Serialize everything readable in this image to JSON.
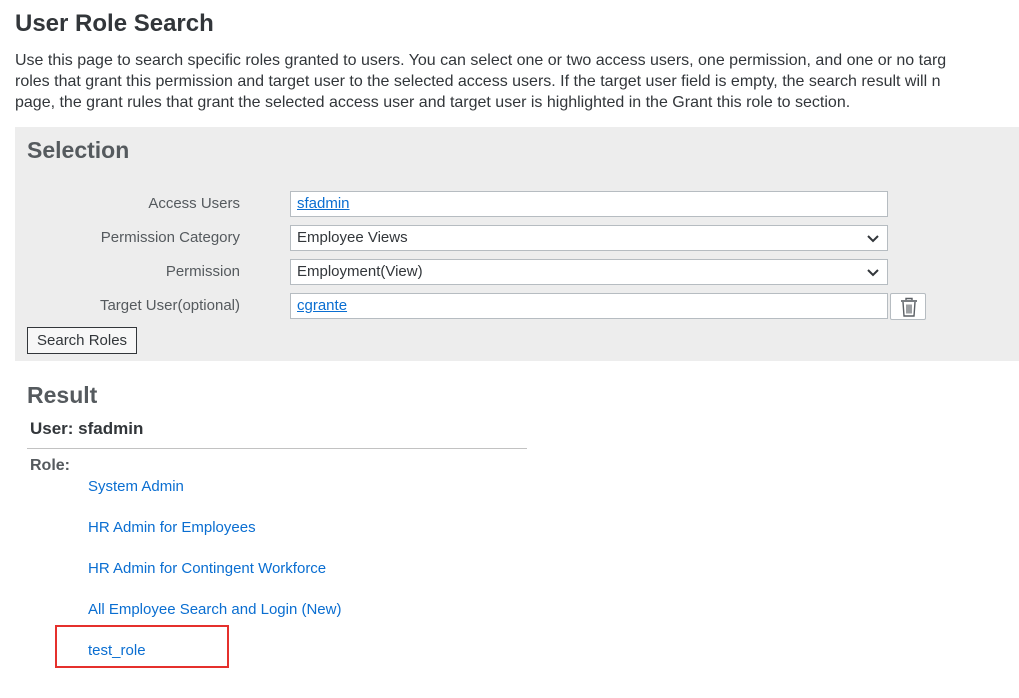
{
  "page": {
    "title": "User Role Search",
    "intro_lines": [
      "Use this page to search specific roles granted to users. You can select one or two access users, one permission, and one or no targ",
      "roles that grant this permission and target user to the selected access users. If the target user field is empty, the search result will n",
      "page, the grant rules that grant the selected access user and target user is highlighted in the Grant this role to section."
    ]
  },
  "selection": {
    "title": "Selection",
    "access_users": {
      "label": "Access Users",
      "value": "sfadmin"
    },
    "permission_category": {
      "label": "Permission Category",
      "value": "Employee Views",
      "icon": "chevron-down-icon"
    },
    "permission": {
      "label": "Permission",
      "value": "Employment(View)",
      "icon": "chevron-down-icon"
    },
    "target_user": {
      "label": "Target User(optional)",
      "value": "cgrante",
      "clear_icon": "trash-icon"
    },
    "search_button": "Search Roles"
  },
  "result": {
    "title": "Result",
    "user_heading": "User: sfadmin",
    "role_label": "Role:",
    "roles": [
      "System Admin",
      "HR Admin for Employees",
      "HR Admin for Contingent Workforce",
      "All Employee Search and Login (New)",
      "test_role"
    ],
    "highlighted_role": "test_role",
    "highlight_color": "#e5302c"
  },
  "colors": {
    "link": "#0a6ed1",
    "panel_background": "#ededed",
    "text": "#32363a"
  }
}
